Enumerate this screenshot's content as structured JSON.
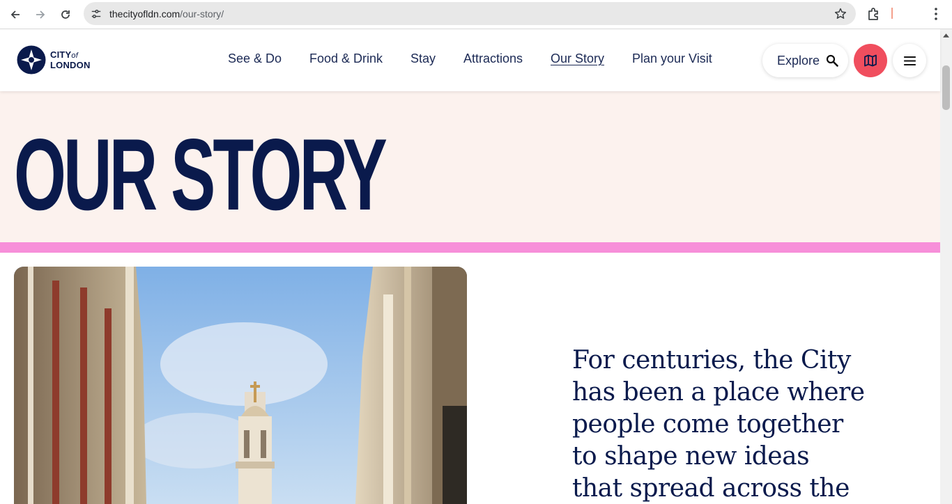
{
  "browser": {
    "url_host": "thecityofldn.com",
    "url_path": "/our-story/"
  },
  "site": {
    "logo": {
      "line1": "CITY",
      "of": "of",
      "line2": "LONDON"
    },
    "nav": [
      {
        "label": "See & Do"
      },
      {
        "label": "Food & Drink"
      },
      {
        "label": "Stay"
      },
      {
        "label": "Attractions"
      },
      {
        "label": "Our Story",
        "active": true
      },
      {
        "label": "Plan your Visit"
      }
    ],
    "explore_label": "Explore"
  },
  "hero": {
    "title": "OUR STORY"
  },
  "intro": {
    "text": "For centuries, the City has been a place where people come together to shape new ideas that spread across the"
  },
  "colors": {
    "navy": "#0a1a4c",
    "hero_bg": "#fcf2ee",
    "pink_stripe": "#f78fd9",
    "map_button": "#f04e5e"
  },
  "icons": [
    "back-arrow-icon",
    "forward-arrow-icon",
    "reload-icon",
    "site-info-icon",
    "bookmark-star-icon",
    "extensions-icon",
    "browser-menu-icon",
    "search-icon",
    "map-icon",
    "hamburger-menu-icon"
  ]
}
